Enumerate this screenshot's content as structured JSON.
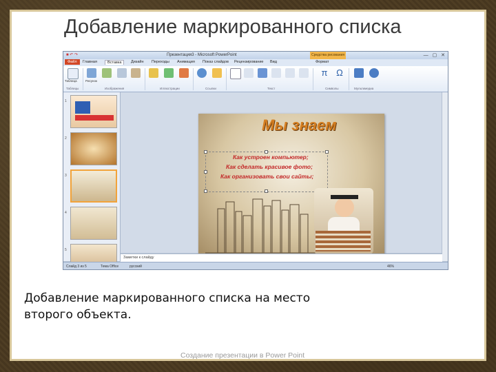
{
  "slide": {
    "title": "Добавление маркированного списка",
    "body": "Добавление маркированного списка на место второго объекта.",
    "footer": "Создание презентации в Power Point"
  },
  "app": {
    "window_title": "Презентация3 - Microsoft PowerPoint",
    "contextual_tab": "Средства рисования",
    "tabs": [
      "Файл",
      "Главная",
      "Вставка",
      "Дизайн",
      "Переходы",
      "Анимация",
      "Показ слайдов",
      "Рецензирование",
      "Вид",
      "Формат"
    ],
    "active_tab": "Вставка",
    "ribbon_groups": [
      "Таблицы",
      "Изображения",
      "Иллюстрации",
      "Ссылки",
      "Текст",
      "Символы",
      "Мультимедиа"
    ],
    "ribbon_buttons": [
      "Таблица",
      "Рисунок",
      "Картинка",
      "Снимок",
      "Фотоальбом",
      "Фигуры",
      "SmartArt",
      "Диаграмма",
      "Гиперссылка",
      "Действие",
      "Надпись",
      "Колонтитулы",
      "WordArt",
      "Дата и время",
      "Номер слайда",
      "Объект",
      "Формула",
      "Символ",
      "Видео",
      "Звук"
    ],
    "notes_placeholder": "Заметки к слайду",
    "status": {
      "slide": "Слайд 3 из 5",
      "theme": "Тема Office",
      "lang": "русский",
      "zoom": "46%"
    }
  },
  "main_slide": {
    "title": "Мы знаем",
    "bullets": [
      "Как устроен компьютер;",
      "Как сделать красивое фото;",
      "Как организовать свои сайты;"
    ]
  },
  "colors": {
    "accent": "#d24726",
    "frame": "#4a3a22",
    "ms_bullet": "#c32929",
    "ms_title": "#d57f22"
  }
}
